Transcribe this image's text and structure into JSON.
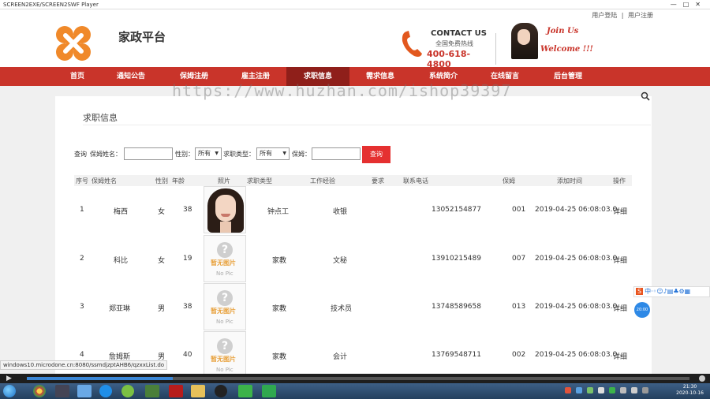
{
  "window": {
    "title": "SCREEN2EXE/SCREEN2SWF Player",
    "controls": "—□✕"
  },
  "header": {
    "top_links": [
      "用户登陆",
      "用户注册"
    ],
    "top_links_sep": "|",
    "site_name": "家政平台",
    "contact_title": "CONTACT US",
    "contact_sub": "全国免费热线",
    "contact_phone": "400-618-4800",
    "join": "Join Us",
    "welcome": "Welcome !!!"
  },
  "nav": {
    "items": [
      "首页",
      "通知公告",
      "保姆注册",
      "雇主注册",
      "求职信息",
      "需求信息",
      "系统简介",
      "在线留言",
      "后台管理"
    ],
    "active_index": 4
  },
  "watermark": "https://www.huzhan.com/ishop39397",
  "page": {
    "title": "求职信息",
    "filter": {
      "label_query": "查询",
      "label_name": "保姆姓名：",
      "label_gender": "性别：",
      "gender_value": "所有",
      "label_type": "求职类型：",
      "type_value": "所有",
      "label_no": "保姆：",
      "button": "查询"
    },
    "table": {
      "headers": [
        "序号",
        "保姆姓名",
        "性别",
        "年龄",
        "照片",
        "求职类型",
        "工作经验",
        "要求",
        "联系电话",
        "保姆",
        "添加时间",
        "操作"
      ],
      "rows": [
        {
          "no": "1",
          "name": "梅西",
          "gender": "女",
          "age": "38",
          "photo": "photo",
          "type": "钟点工",
          "exp": "收银",
          "req": "",
          "phone": "13052154877",
          "code": "001",
          "time": "2019-04-25 06:08:03.0",
          "op": "详细"
        },
        {
          "no": "2",
          "name": "科比",
          "gender": "女",
          "age": "19",
          "photo": "nopic",
          "type": "家教",
          "exp": "文秘",
          "req": "",
          "phone": "13910215489",
          "code": "007",
          "time": "2019-04-25 06:08:03.0",
          "op": "详细"
        },
        {
          "no": "3",
          "name": "郑亚琳",
          "gender": "男",
          "age": "38",
          "photo": "nopic",
          "type": "家教",
          "exp": "技术员",
          "req": "",
          "phone": "13748589658",
          "code": "013",
          "time": "2019-04-25 06:08:03.0",
          "op": "详细"
        },
        {
          "no": "4",
          "name": "詹姆斯",
          "gender": "男",
          "age": "40",
          "photo": "nopic",
          "type": "家教",
          "exp": "会计",
          "req": "",
          "phone": "13769548711",
          "code": "002",
          "time": "2019-04-25 06:08:03.0",
          "op": "详细"
        }
      ],
      "nopic_cn": "暂无图片",
      "nopic_en": "No Pic"
    }
  },
  "status_url": "windows10.microdone.cn:8080/ssmdjzptAHB6/qzxxList.do",
  "ime": {
    "label": "S",
    "icons": "中·◦☺♪▤♣⚙▦"
  },
  "bubble": "20:00",
  "taskbar": {
    "time": "21:30",
    "date": "2020-10-16"
  },
  "player": {
    "progress": 0.22
  },
  "colors": {
    "brand_red": "#c9342a",
    "button_red": "#e53030"
  },
  "icons": {
    "search": "search-icon",
    "phone": "phone-icon",
    "logo": "logo-x-icon"
  }
}
